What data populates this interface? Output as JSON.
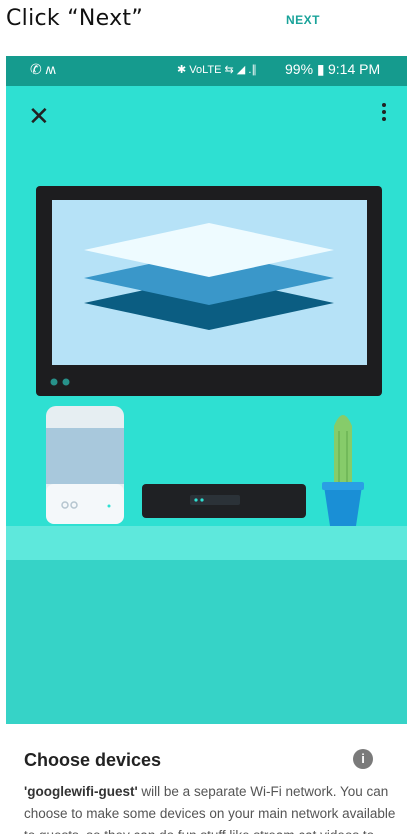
{
  "instruction": {
    "text": "Click “Next”"
  },
  "header": {
    "next_label": "NEXT"
  },
  "status_bar": {
    "left_icons": "✆ ʍ",
    "network_icons": "✱ VoLTE ⇆ ◢ .∥",
    "battery": "99% ▮",
    "time": "9:14 PM"
  },
  "toolbar": {
    "close_icon": "close-icon",
    "menu_icon": "more-vert-icon"
  },
  "card": {
    "title": "Choose devices",
    "network_name": "'googlewifi-guest'",
    "body_text": " will be a separate Wi-Fi network. You can choose to make some devices on your main network available to guests, so they can do fun stuff like stream cat videos to your TV."
  },
  "colors": {
    "accent": "#1aa39a",
    "status_bar": "#159b8e",
    "hero_background": "#2ee0d2",
    "floor": "#36d3c7"
  }
}
